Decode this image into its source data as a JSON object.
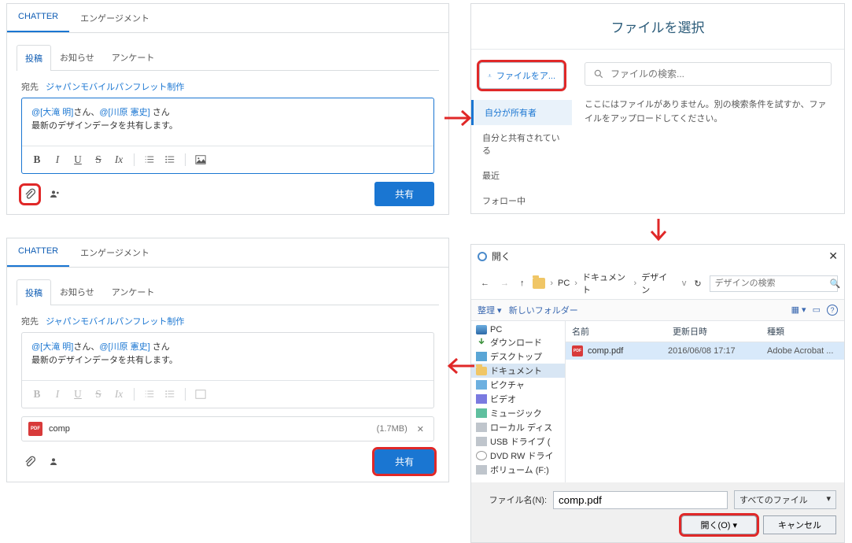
{
  "panel1": {
    "tab_chatter": "CHATTER",
    "tab_engage": "エンゲージメント",
    "stab_post": "投稿",
    "stab_notice": "お知らせ",
    "stab_poll": "アンケート",
    "recip_label": "宛先",
    "recip_name": "ジャパンモバイルパンフレット制作",
    "body_line1_pre": "@[大滝 明]",
    "body_line1_mid": "さん、",
    "body_line1_mention2": "@[川原 憲史]",
    "body_line1_post": " さん",
    "body_line2": "最新のデザインデータを共有します。",
    "toolbar": {
      "b": "B",
      "i": "I",
      "u": "U",
      "s": "S",
      "tx": "Ix"
    },
    "share": "共有"
  },
  "panel2": {
    "title": "ファイルを選択",
    "upload": "ファイルをア...",
    "nav": [
      "自分が所有者",
      "自分と共有されている",
      "最近",
      "フォロー中"
    ],
    "search_ph": "ファイルの検索...",
    "empty": "ここにはファイルがありません。別の検索条件を試すか、ファイルをアップロードしてください。"
  },
  "panel3": {
    "att_name": "comp",
    "att_size": "(1.7MB)"
  },
  "windlg": {
    "title": "開く",
    "crumbs": [
      "PC",
      "ドキュメント",
      "デザイン"
    ],
    "search_ph": "デザインの検索",
    "bar_left": "整理 ▾",
    "bar_right": "新しいフォルダー",
    "tree": [
      "PC",
      "ダウンロード",
      "デスクトップ",
      "ドキュメント",
      "ピクチャ",
      "ビデオ",
      "ミュージック",
      "ローカル ディス",
      "USB ドライブ (",
      "DVD RW ドライ",
      "ボリューム (F:)"
    ],
    "cols": {
      "name": "名前",
      "date": "更新日時",
      "type": "種類"
    },
    "file": {
      "name": "comp.pdf",
      "date": "2016/06/08 17:17",
      "type": "Adobe Acrobat ..."
    },
    "fname_label": "ファイル名(N):",
    "fname_val": "comp.pdf",
    "filter": "すべてのファイル",
    "open": "開く(O)",
    "cancel": "キャンセル"
  }
}
